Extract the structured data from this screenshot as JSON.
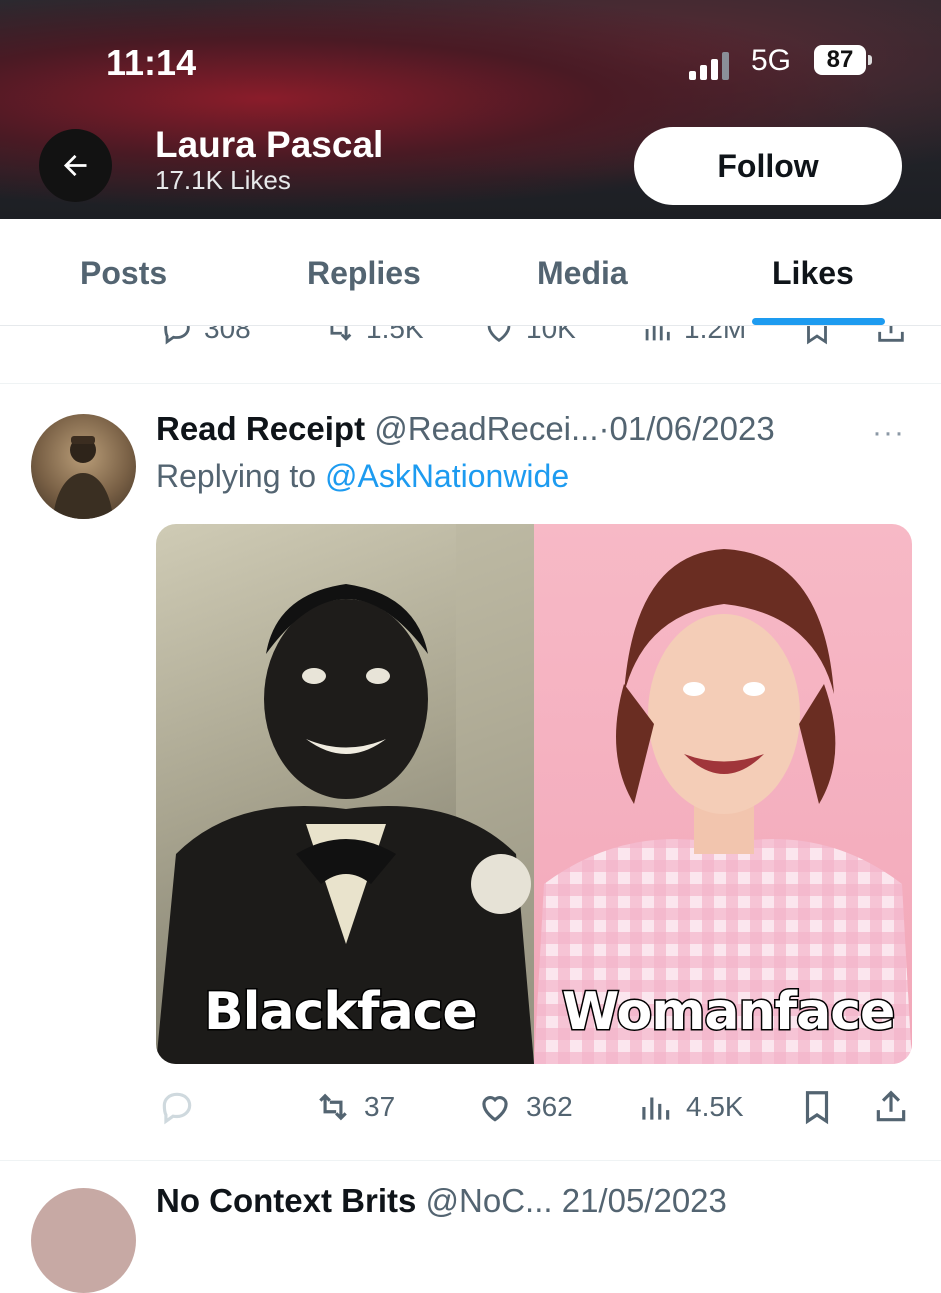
{
  "status_bar": {
    "time": "11:14",
    "network": "5G",
    "battery": "87"
  },
  "header": {
    "name": "Laura Pascal",
    "likes": "17.1K Likes",
    "follow_label": "Follow"
  },
  "tabs": [
    {
      "label": "Posts",
      "active": false
    },
    {
      "label": "Replies",
      "active": false
    },
    {
      "label": "Media",
      "active": false
    },
    {
      "label": "Likes",
      "active": true
    }
  ],
  "previous_post": {
    "replies": "308",
    "reposts": "1.5K",
    "likes": "10K",
    "views": "1.2M"
  },
  "tweet": {
    "author_name": "Read Receipt",
    "handle": "@ReadRecei...",
    "separator": "·",
    "date": "01/06/2023",
    "replying_prefix": "Replying to",
    "replying_to": "@AskNationwide",
    "media": {
      "left_caption": "Blackface",
      "right_caption": "Womanface"
    },
    "actions": {
      "reposts": "37",
      "likes": "362",
      "views": "4.5K"
    }
  },
  "next_post": {
    "author_name": "No Context Brits",
    "handle": "@NoC...",
    "date": "21/05/2023"
  },
  "colors": {
    "accent": "#1d9bf0",
    "secondary_text": "#536471",
    "primary_text": "#0f1419"
  }
}
